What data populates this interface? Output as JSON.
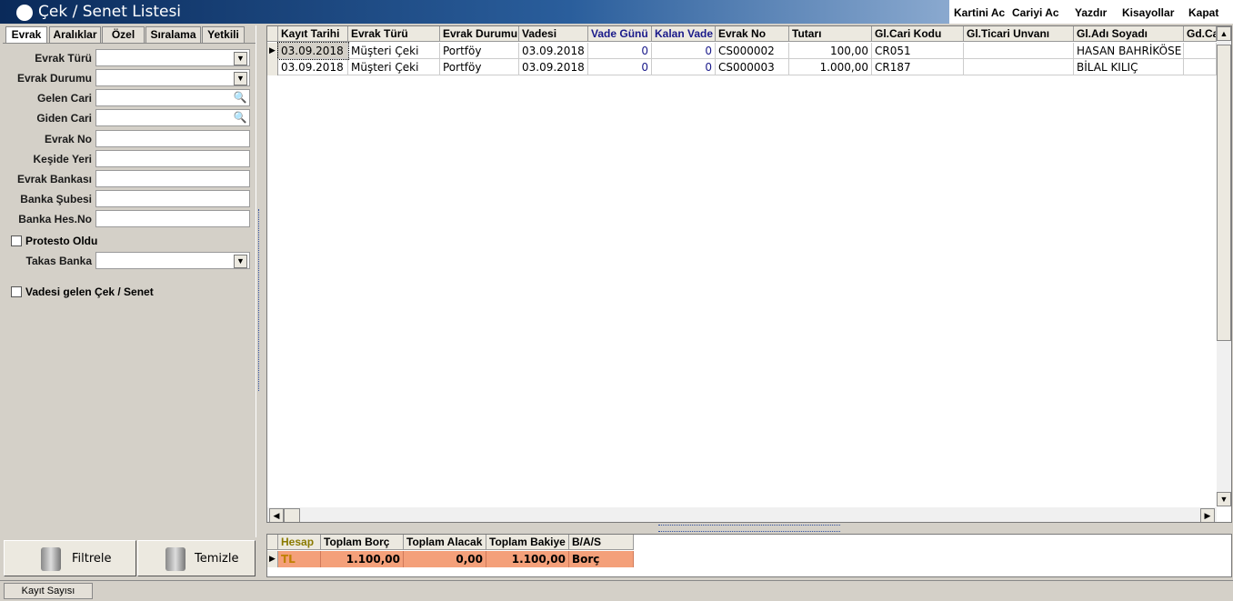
{
  "window": {
    "title": "Çek / Senet Listesi"
  },
  "menu": {
    "kartini_ac": "Kartini Ac",
    "cariyi_ac": "Cariyi Ac",
    "yazdir": "Yazdır",
    "kisayollar": "Kisayollar",
    "kapat": "Kapat"
  },
  "tabs": [
    "Evrak",
    "Aralıklar",
    "Özel",
    "Sıralama",
    "Yetkili"
  ],
  "filters": {
    "evrak_turu": "Evrak Türü",
    "evrak_durumu": "Evrak Durumu",
    "gelen_cari": "Gelen Cari",
    "giden_cari": "Giden Cari",
    "evrak_no": "Evrak No",
    "keside_yeri": "Keşide Yeri",
    "evrak_bankasi": "Evrak Bankası",
    "banka_subesi": "Banka Şubesi",
    "banka_hes_no": "Banka Hes.No",
    "protesto_oldu": "Protesto Oldu",
    "takas_banka": "Takas Banka",
    "vadesi_gelen": "Vadesi gelen Çek / Senet"
  },
  "buttons": {
    "filtrele": "Filtrele",
    "temizle": "Temizle"
  },
  "grid": {
    "columns": [
      "Kayıt Tarihi",
      "Evrak Türü",
      "Evrak Durumu",
      "Vadesi",
      "Vade Günü",
      "Kalan Vade",
      "Evrak No",
      "Tutarı",
      "Gl.Cari Kodu",
      "Gl.Ticari Unvanı",
      "Gl.Adı Soyadı",
      "Gd.Ca"
    ],
    "rows": [
      [
        "03.09.2018",
        "Müşteri Çeki",
        "Portföy",
        "03.09.2018",
        "0",
        "0",
        "CS000002",
        "100,00",
        "CR051",
        "",
        "HASAN BAHRİKÖSE",
        ""
      ],
      [
        "03.09.2018",
        "Müşteri Çeki",
        "Portföy",
        "03.09.2018",
        "0",
        "0",
        "CS000003",
        "1.000,00",
        "CR187",
        "",
        "BİLAL KILIÇ",
        ""
      ]
    ]
  },
  "totals": {
    "columns": [
      "Hesap",
      "Toplam Borç",
      "Toplam Alacak",
      "Toplam Bakiye",
      "B/A/S"
    ],
    "row": [
      "TL",
      "1.100,00",
      "0,00",
      "1.100,00",
      "Borç"
    ]
  },
  "status": {
    "kayit_sayisi": "Kayıt Sayısı"
  },
  "colors": {
    "title_blue": "#0a2a5a",
    "total_row": "#f4a07a",
    "hesap_header": "#8a7a00"
  }
}
